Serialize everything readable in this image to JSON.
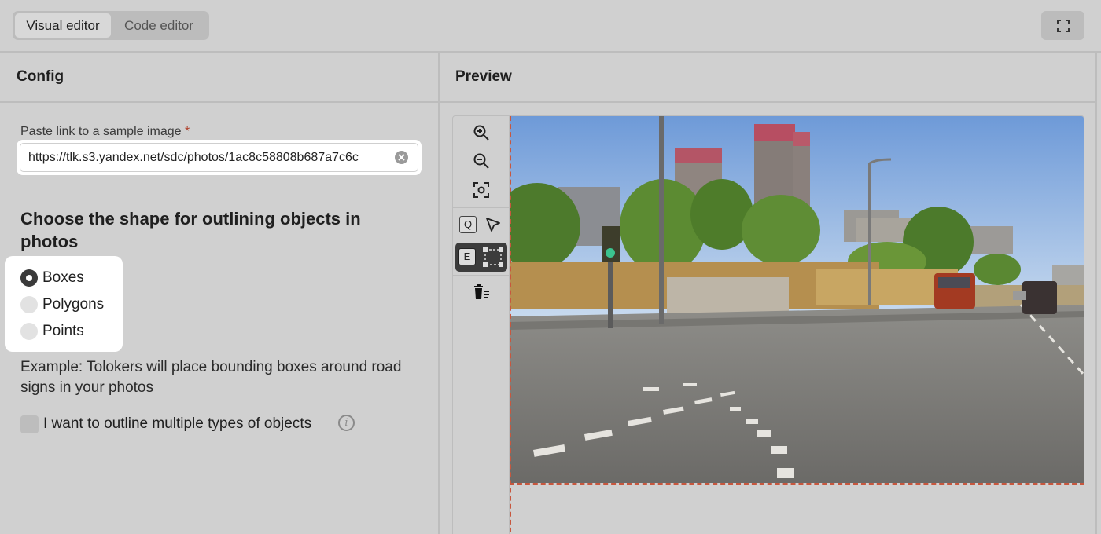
{
  "tabs": {
    "visual": "Visual editor",
    "code": "Code editor"
  },
  "panels": {
    "config_title": "Config",
    "preview_title": "Preview"
  },
  "url_field": {
    "label": "Paste link to a sample image",
    "required_mark": "*",
    "value": "https://tlk.s3.yandex.net/sdc/photos/1ac8c58808b687a7c6c"
  },
  "shape_section": {
    "title": "Choose the shape for outlining objects in photos",
    "options": [
      {
        "label": "Boxes",
        "selected": true
      },
      {
        "label": "Polygons",
        "selected": false
      },
      {
        "label": "Points",
        "selected": false
      }
    ],
    "example": "Example: Tolokers will place bounding boxes around road signs in your photos"
  },
  "multiple_types": {
    "label": "I want to outline multiple types of objects",
    "checked": false,
    "info_glyph": "i"
  },
  "toolbar": {
    "icons": [
      "zoom-in-icon",
      "zoom-out-icon",
      "fit-screen-icon",
      "pointer-icon",
      "bounding-box-icon",
      "delete-all-icon"
    ],
    "keys": {
      "select": "Q",
      "box": "E"
    }
  },
  "colors": {
    "accent_dashed": "#c8573e",
    "background": "#d0d0d0",
    "selected_radio": "#3a3a3a"
  }
}
